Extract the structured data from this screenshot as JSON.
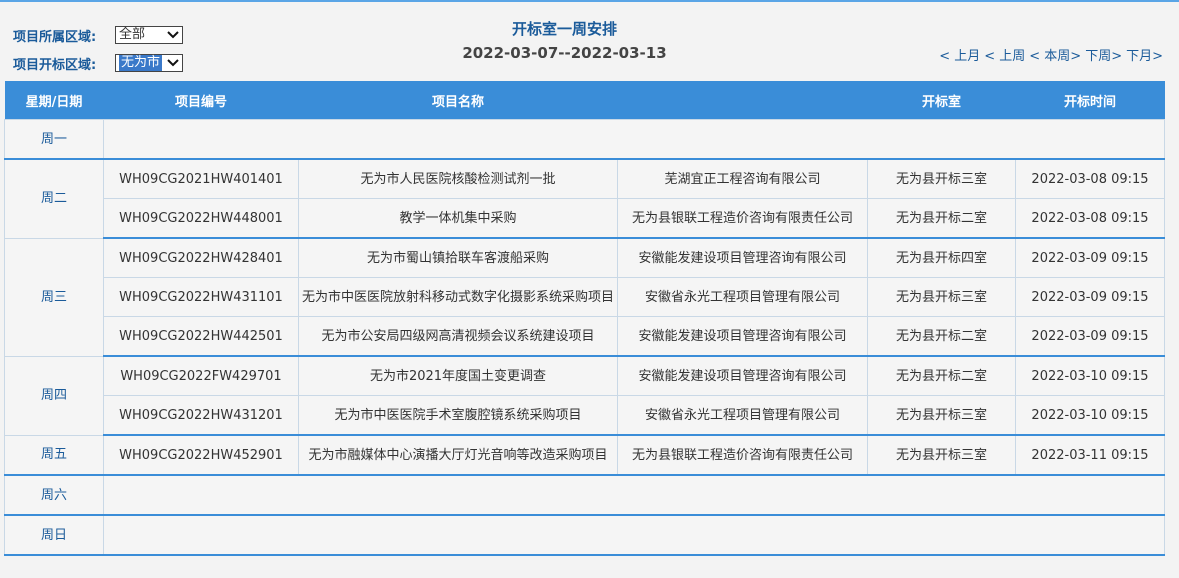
{
  "filters": {
    "region_label": "项目所属区域:",
    "region_value": "全部",
    "area_label": "项目开标区域:",
    "area_value": "无为市"
  },
  "title": {
    "main": "开标室一周安排",
    "range": "2022-03-07--2022-03-13"
  },
  "nav": {
    "prev_month": "< 上月",
    "prev_week": "< 上周",
    "this_week": "< 本周>",
    "next_week": "下周>",
    "next_month": "下月>"
  },
  "table": {
    "headers": [
      "星期/日期",
      "项目编号",
      "项目名称",
      "",
      "开标室",
      "开标时间"
    ],
    "days": [
      {
        "day": "周一",
        "rows": []
      },
      {
        "day": "周二",
        "rows": [
          {
            "code": "WH09CG2021HW401401",
            "name": "无为市人民医院核酸检测试剂一批",
            "agency": "芜湖宜正工程咨询有限公司",
            "room": "无为县开标三室",
            "time": "2022-03-08 09:15"
          },
          {
            "code": "WH09CG2022HW448001",
            "name": "教学一体机集中采购",
            "agency": "无为县银联工程造价咨询有限责任公司",
            "room": "无为县开标二室",
            "time": "2022-03-08 09:15"
          }
        ]
      },
      {
        "day": "周三",
        "rows": [
          {
            "code": "WH09CG2022HW428401",
            "name": "无为市蜀山镇拾联车客渡船采购",
            "agency": "安徽能发建设项目管理咨询有限公司",
            "room": "无为县开标四室",
            "time": "2022-03-09 09:15"
          },
          {
            "code": "WH09CG2022HW431101",
            "name": "无为市中医医院放射科移动式数字化摄影系统采购项目",
            "agency": "安徽省永光工程项目管理有限公司",
            "room": "无为县开标三室",
            "time": "2022-03-09 09:15"
          },
          {
            "code": "WH09CG2022HW442501",
            "name": "无为市公安局四级网高清视频会议系统建设项目",
            "agency": "安徽能发建设项目管理咨询有限公司",
            "room": "无为县开标二室",
            "time": "2022-03-09 09:15"
          }
        ]
      },
      {
        "day": "周四",
        "rows": [
          {
            "code": "WH09CG2022FW429701",
            "name": "无为市2021年度国土变更调查",
            "agency": "安徽能发建设项目管理咨询有限公司",
            "room": "无为县开标二室",
            "time": "2022-03-10 09:15"
          },
          {
            "code": "WH09CG2022HW431201",
            "name": "无为市中医医院手术室腹腔镜系统采购项目",
            "agency": "安徽省永光工程项目管理有限公司",
            "room": "无为县开标三室",
            "time": "2022-03-10 09:15"
          }
        ]
      },
      {
        "day": "周五",
        "rows": [
          {
            "code": "WH09CG2022HW452901",
            "name": "无为市融媒体中心演播大厅灯光音响等改造采购项目",
            "agency": "无为县银联工程造价咨询有限责任公司",
            "room": "无为县开标三室",
            "time": "2022-03-11 09:15"
          }
        ]
      },
      {
        "day": "周六",
        "rows": []
      },
      {
        "day": "周日",
        "rows": []
      }
    ]
  }
}
